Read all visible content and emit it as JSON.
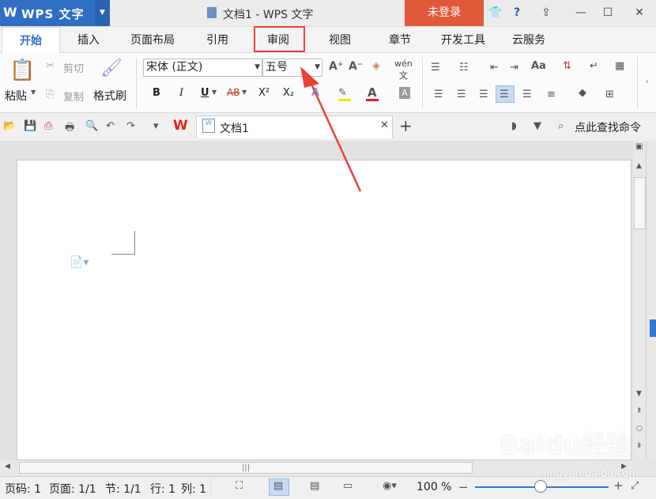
{
  "app": {
    "logo_letter": "W",
    "name": "WPS 文字",
    "window_title": "文档1 - WPS 文字",
    "login": "未登录"
  },
  "tabs": [
    "开始",
    "插入",
    "页面布局",
    "引用",
    "审阅",
    "视图",
    "章节",
    "开发工具",
    "云服务"
  ],
  "ribbon": {
    "paste": "粘贴",
    "cut": "剪切",
    "copy": "复制",
    "format_painter": "格式刷",
    "font_name": "宋体 (正文)",
    "font_size": "五号",
    "bold": "B",
    "italic": "I",
    "underline": "U",
    "strikethrough": "AB",
    "superscript": "X²",
    "subscript": "X₂"
  },
  "document": {
    "tab_label": "文档1",
    "new_tab": "+",
    "search_command": "点此查找命令"
  },
  "status": {
    "page_no": "页码: 1",
    "pages": "页面: 1/1",
    "section": "节: 1/1",
    "row": "行: 1",
    "col": "列: 1",
    "zoom": "100 %"
  },
  "watermark": {
    "brand": "Baidu经验",
    "url": "jingyan.baidu.com"
  },
  "colors": {
    "accent": "#2f6ec3",
    "login": "#e05a3a",
    "highlight_box": "#e8413a"
  }
}
